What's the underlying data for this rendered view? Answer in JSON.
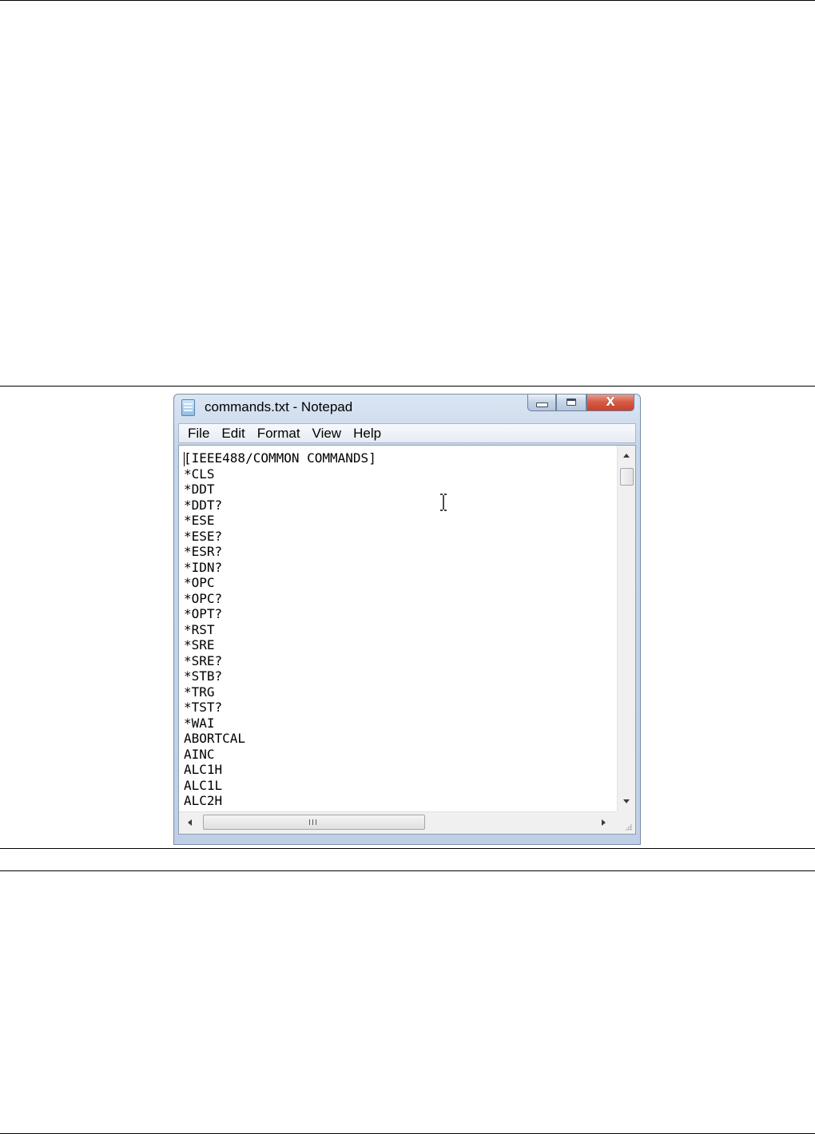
{
  "window": {
    "title": "commands.txt - Notepad",
    "app_icon": "notepad-icon",
    "controls": {
      "minimize_icon": "minimize-icon",
      "maximize_icon": "maximize-icon",
      "close_icon": "close-icon",
      "close_glyph": "X",
      "close_color": "#c8412c"
    }
  },
  "menu": {
    "items": [
      "File",
      "Edit",
      "Format",
      "View",
      "Help"
    ]
  },
  "editor": {
    "lines": [
      "[IEEE488/COMMON COMMANDS]",
      "*CLS",
      "*DDT",
      "*DDT?",
      "*ESE",
      "*ESE?",
      "*ESR?",
      "*IDN?",
      "*OPC",
      "*OPC?",
      "*OPT?",
      "*RST",
      "*SRE",
      "*SRE?",
      "*STB?",
      "*TRG",
      "*TST?",
      "*WAI",
      "ABORTCAL",
      "AINC",
      "ALC1H",
      "ALC1L",
      "ALC2H"
    ],
    "scrollbar_grip": "III"
  }
}
